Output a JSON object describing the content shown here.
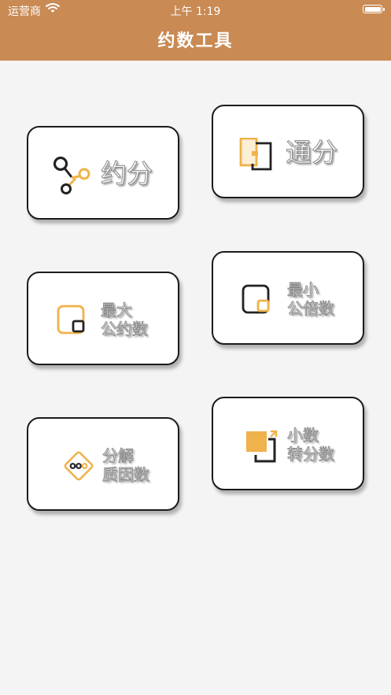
{
  "status_bar": {
    "carrier": "运营商",
    "time": "上午 1:19"
  },
  "header": {
    "title": "约数工具"
  },
  "accent_color": "#f0b24a",
  "header_color": "#c98a53",
  "tools": [
    {
      "label": "约分",
      "icon": "share-nodes-icon"
    },
    {
      "label": "通分",
      "icon": "overlapping-rectangles-icon"
    },
    {
      "label_line1": "最大",
      "label_line2": "公约数",
      "icon": "nested-squares-icon"
    },
    {
      "label_line1": "最小",
      "label_line2": "公倍数",
      "icon": "nested-squares-icon"
    },
    {
      "label_line1": "分解",
      "label_line2": "质因数",
      "icon": "diamond-dots-icon"
    },
    {
      "label_line1": "小数",
      "label_line2": "转分数",
      "icon": "square-bracket-arrow-icon"
    }
  ]
}
